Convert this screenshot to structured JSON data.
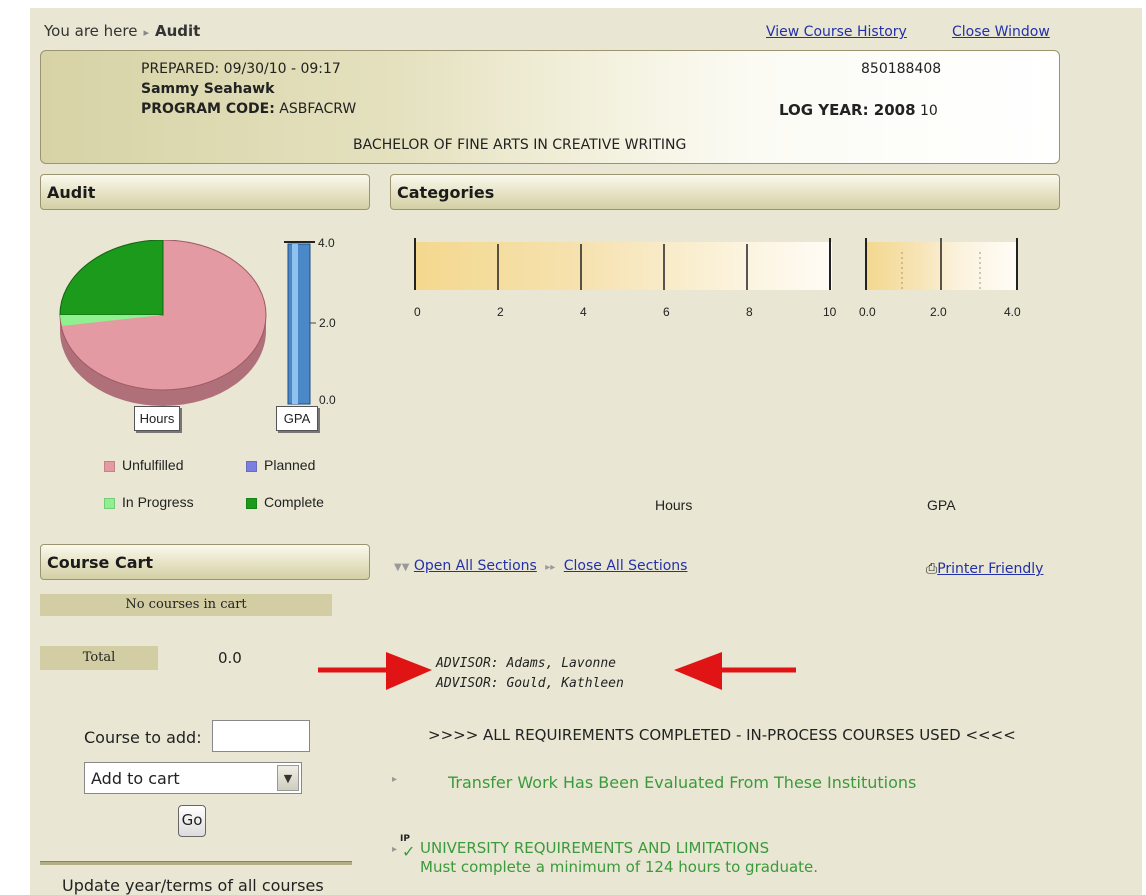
{
  "breadcrumb": {
    "prefix": "You are here",
    "current": "Audit"
  },
  "top_links": {
    "history": "View Course History",
    "close": "Close Window"
  },
  "info": {
    "prepared": "PREPARED: 09/30/10 - 09:17",
    "id_number": "850188408",
    "student_name": "Sammy Seahawk",
    "program_code_label": "PROGRAM CODE:",
    "program_code": "ASBFACRW",
    "log_year_label": "LOG YEAR: 2008",
    "log_year_term": "10",
    "degree": "BACHELOR OF FINE ARTS IN CREATIVE WRITING"
  },
  "audit": {
    "header": "Audit",
    "hours_label": "Hours",
    "gpa_label": "GPA",
    "gpa_ticks": [
      "4.0",
      "2.0",
      "0.0"
    ],
    "legend": [
      {
        "label": "Unfulfilled",
        "color": "#e49aa2"
      },
      {
        "label": "Planned",
        "color": "#7b80e0"
      },
      {
        "label": "In Progress",
        "color": "#8ef08e"
      },
      {
        "label": "Complete",
        "color": "#1c9a1c"
      }
    ]
  },
  "categories": {
    "header": "Categories",
    "hours_ticks": [
      "0",
      "2",
      "4",
      "6",
      "8",
      "10"
    ],
    "gpa_ticks": [
      "0.0",
      "2.0",
      "4.0"
    ],
    "hours_caption": "Hours",
    "gpa_caption": "GPA"
  },
  "course_cart": {
    "header": "Course Cart",
    "empty_text": "No courses in cart",
    "total_label": "Total",
    "total_value": "0.0",
    "course_to_add_label": "Course to add:",
    "add_select_value": "Add to cart",
    "go_label": "Go",
    "update_text": "Update year/terms of all courses"
  },
  "sections": {
    "open_all": "Open All Sections",
    "close_all": "Close All Sections",
    "printer": "Printer Friendly"
  },
  "advisors": [
    "ADVISOR: Adams, Lavonne",
    "ADVISOR: Gould, Kathleen"
  ],
  "status_line": ">>>> ALL REQUIREMENTS COMPLETED - IN-PROCESS COURSES USED <<<<",
  "requirements": {
    "transfer": "Transfer Work Has Been Evaluated From These Institutions",
    "univ_title": "UNIVERSITY REQUIREMENTS AND LIMITATIONS",
    "univ_sub": "Must complete a minimum of 124 hours to graduate.",
    "ip_badge": "IP"
  }
}
